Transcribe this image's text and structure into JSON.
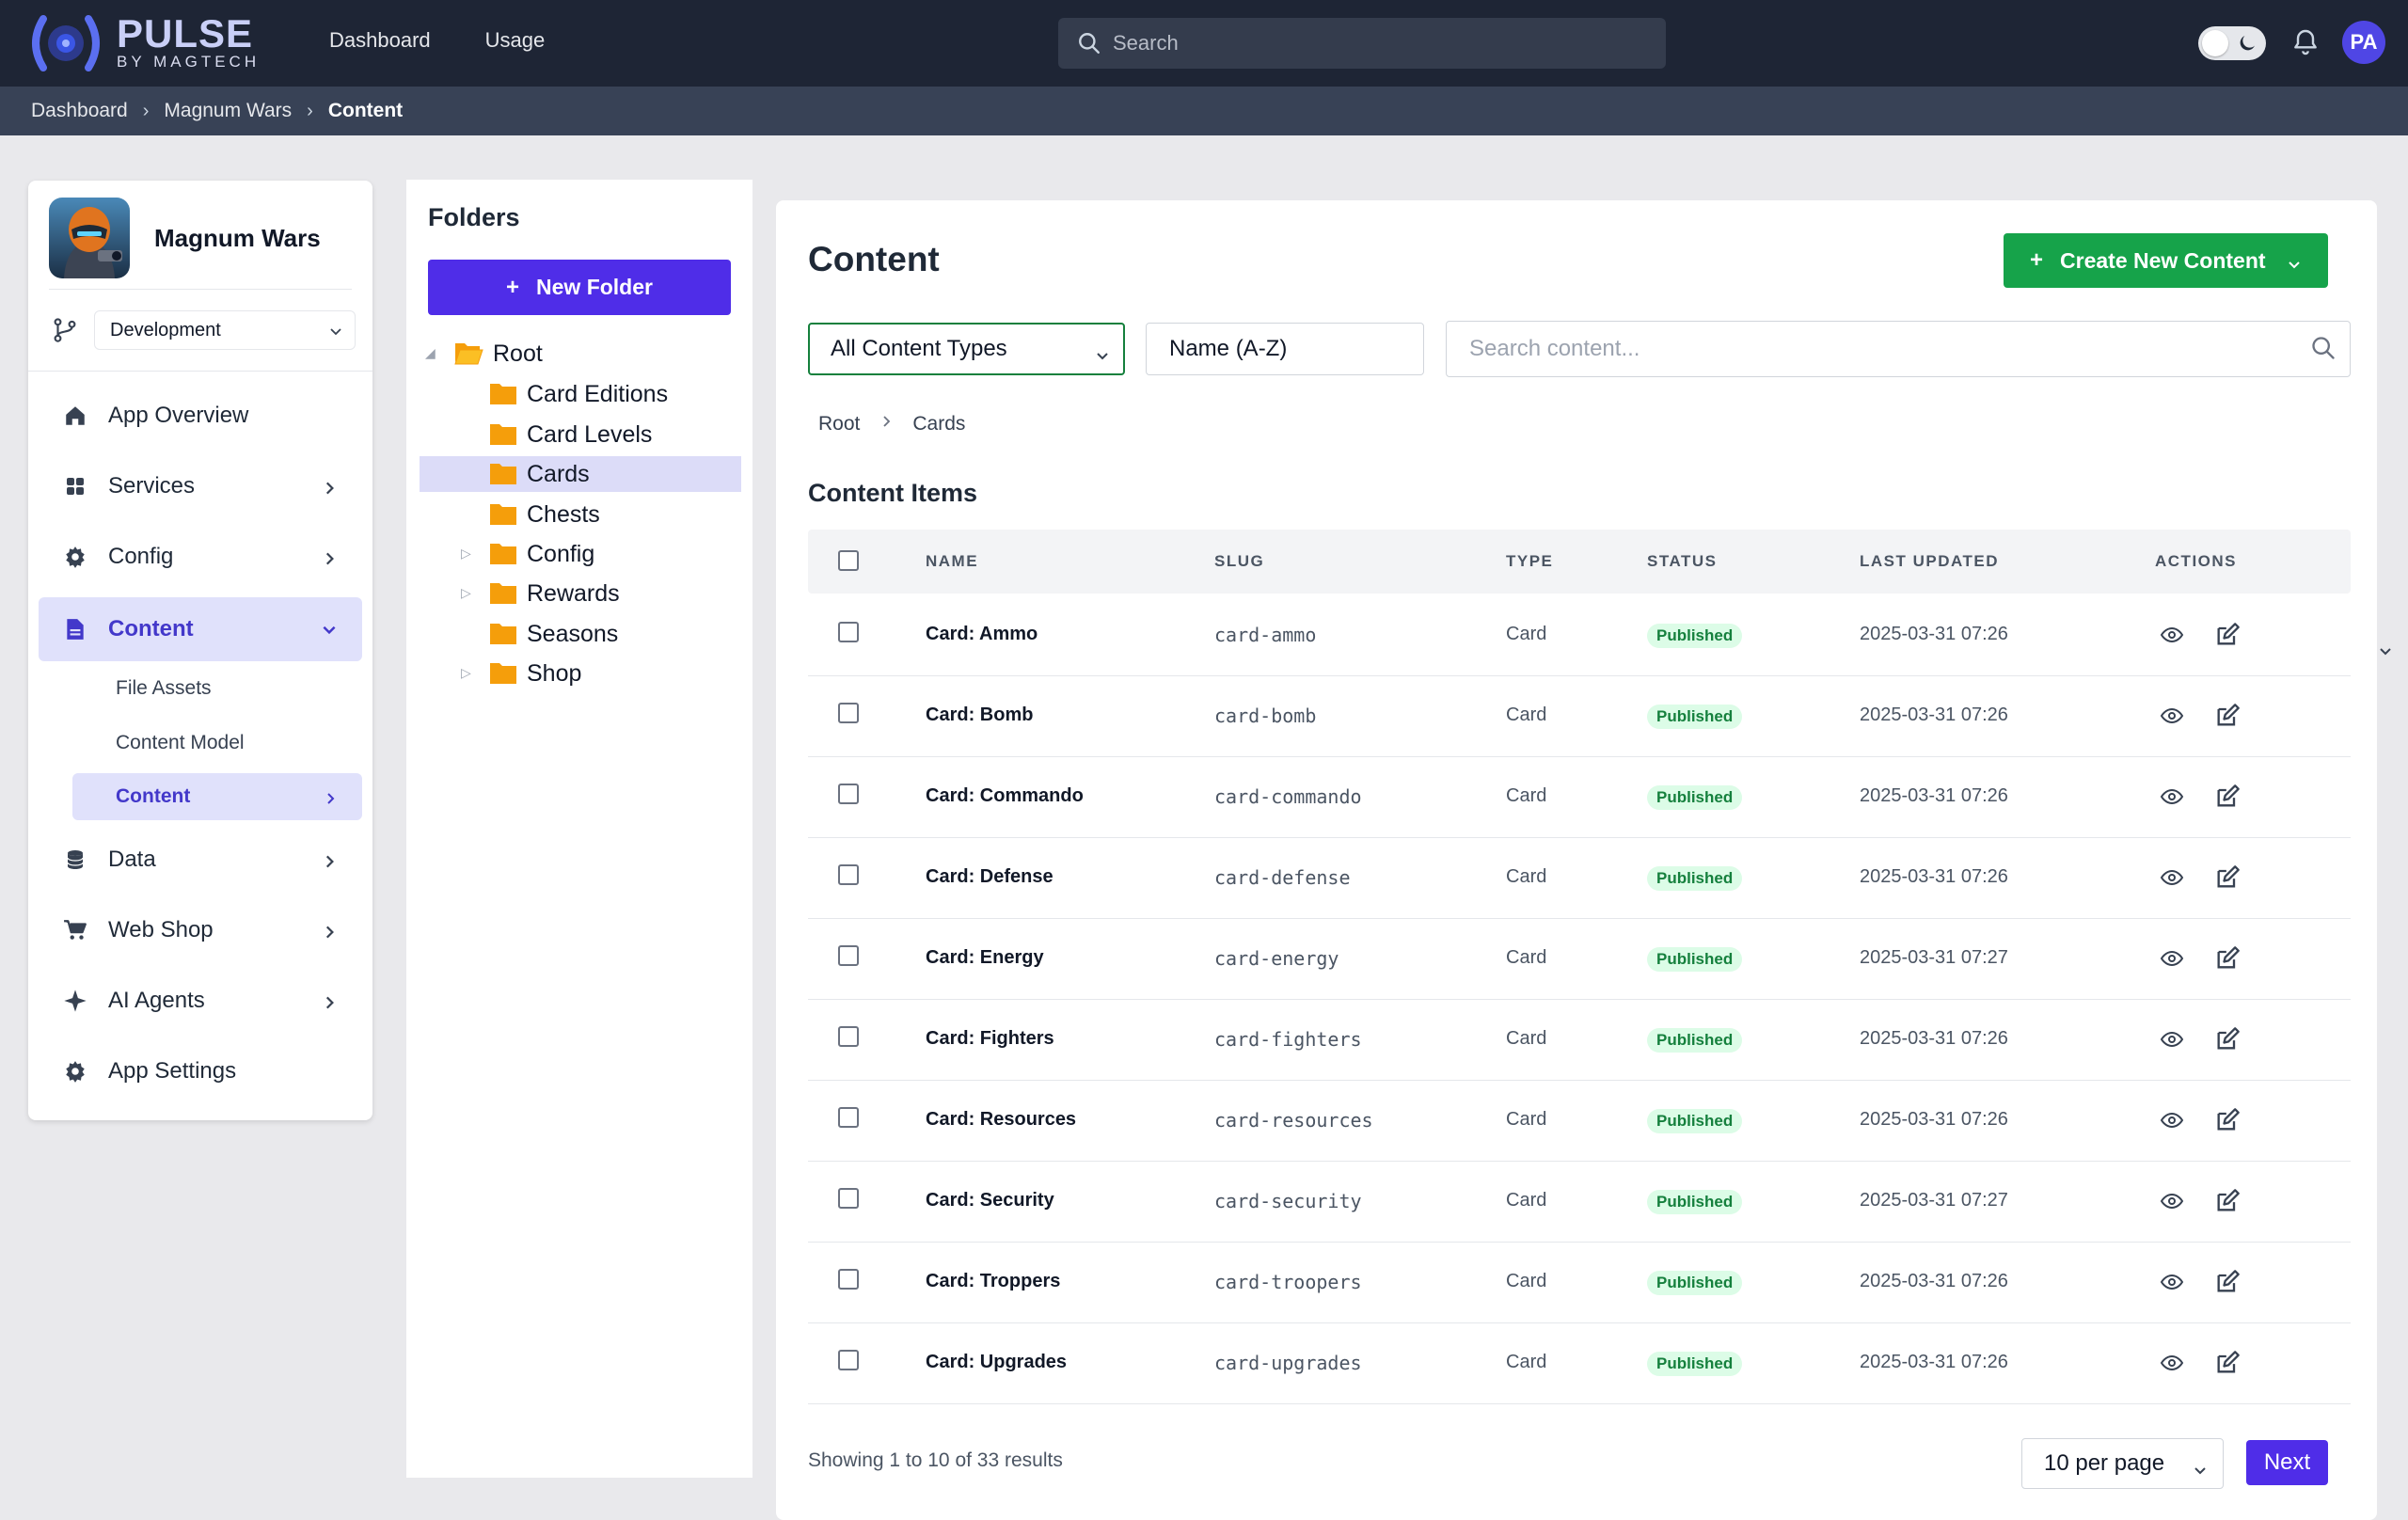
{
  "brand": {
    "name": "PULSE",
    "sub": "BY MAGTECH"
  },
  "topnav": [
    {
      "label": "Dashboard"
    },
    {
      "label": "Usage"
    }
  ],
  "search": {
    "placeholder": "Search"
  },
  "user": {
    "initials": "PA"
  },
  "breadcrumb": [
    "Dashboard",
    "Magnum Wars",
    "Content"
  ],
  "sidebar": {
    "app_name": "Magnum Wars",
    "environment": "Development",
    "items": [
      {
        "label": "App Overview",
        "icon": "home-icon"
      },
      {
        "label": "Services",
        "icon": "grid-icon"
      },
      {
        "label": "Config",
        "icon": "gear-icon"
      },
      {
        "label": "Content",
        "icon": "document-icon"
      },
      {
        "label": "Data",
        "icon": "database-icon"
      },
      {
        "label": "Web Shop",
        "icon": "cart-icon"
      },
      {
        "label": "AI Agents",
        "icon": "sparkle-icon"
      },
      {
        "label": "App Settings",
        "icon": "gear-icon"
      }
    ],
    "subitems": [
      {
        "label": "File Assets"
      },
      {
        "label": "Content Model"
      },
      {
        "label": "Content"
      }
    ]
  },
  "folders": {
    "title": "Folders",
    "new_folder": "New Folder",
    "tree": [
      {
        "label": "Root"
      },
      {
        "label": "Card Editions"
      },
      {
        "label": "Card Levels"
      },
      {
        "label": "Cards"
      },
      {
        "label": "Chests"
      },
      {
        "label": "Config"
      },
      {
        "label": "Rewards"
      },
      {
        "label": "Seasons"
      },
      {
        "label": "Shop"
      }
    ]
  },
  "content": {
    "title": "Content",
    "create_label": "Create New Content",
    "type_filter": "All Content Types",
    "sort": "Name (A-Z)",
    "search_placeholder": "Search content...",
    "path": [
      "Root",
      "Cards"
    ],
    "section_title": "Content Items",
    "columns": [
      "NAME",
      "SLUG",
      "TYPE",
      "STATUS",
      "LAST UPDATED",
      "ACTIONS"
    ],
    "rows": [
      {
        "name": "Card: Ammo",
        "slug": "card-ammo",
        "type": "Card",
        "status": "Published",
        "updated": "2025-03-31 07:26"
      },
      {
        "name": "Card: Bomb",
        "slug": "card-bomb",
        "type": "Card",
        "status": "Published",
        "updated": "2025-03-31 07:26"
      },
      {
        "name": "Card: Commando",
        "slug": "card-commando",
        "type": "Card",
        "status": "Published",
        "updated": "2025-03-31 07:26"
      },
      {
        "name": "Card: Defense",
        "slug": "card-defense",
        "type": "Card",
        "status": "Published",
        "updated": "2025-03-31 07:26"
      },
      {
        "name": "Card: Energy",
        "slug": "card-energy",
        "type": "Card",
        "status": "Published",
        "updated": "2025-03-31 07:27"
      },
      {
        "name": "Card: Fighters",
        "slug": "card-fighters",
        "type": "Card",
        "status": "Published",
        "updated": "2025-03-31 07:26"
      },
      {
        "name": "Card: Resources",
        "slug": "card-resources",
        "type": "Card",
        "status": "Published",
        "updated": "2025-03-31 07:26"
      },
      {
        "name": "Card: Security",
        "slug": "card-security",
        "type": "Card",
        "status": "Published",
        "updated": "2025-03-31 07:27"
      },
      {
        "name": "Card: Troppers",
        "slug": "card-troopers",
        "type": "Card",
        "status": "Published",
        "updated": "2025-03-31 07:26"
      },
      {
        "name": "Card: Upgrades",
        "slug": "card-upgrades",
        "type": "Card",
        "status": "Published",
        "updated": "2025-03-31 07:26"
      }
    ],
    "showing": "Showing 1 to 10 of 33 results",
    "per_page": "10 per page",
    "next": "Next"
  },
  "colors": {
    "primary": "#4f2de8",
    "success": "#16a34a",
    "topbar": "#1e2535",
    "crumbbar": "#384256",
    "folder": "#f59e0b"
  }
}
